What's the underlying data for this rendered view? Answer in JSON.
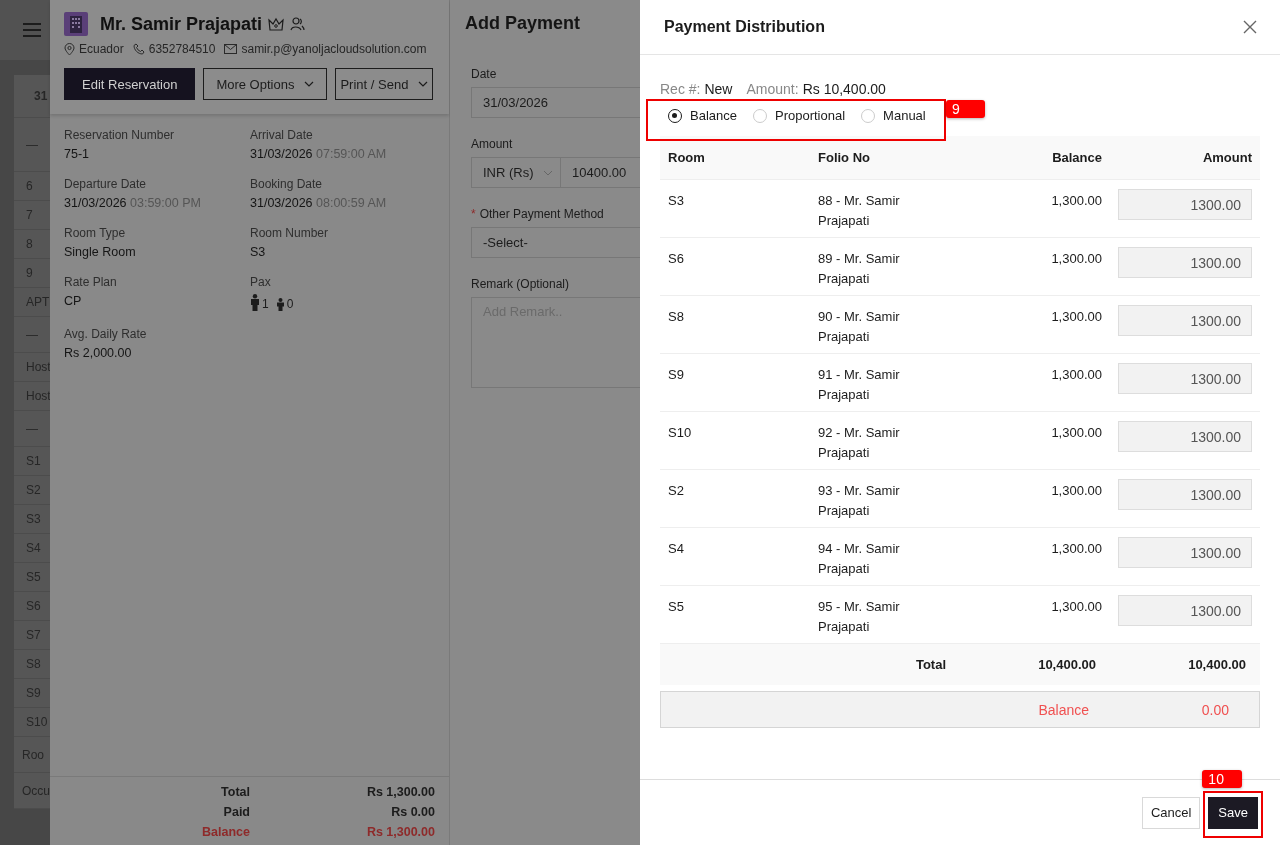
{
  "background_list": {
    "rows": [
      {
        "kind": "header",
        "text": "31"
      },
      {
        "kind": "group",
        "text": "—"
      },
      {
        "kind": "row",
        "text": "6"
      },
      {
        "kind": "row",
        "text": "7"
      },
      {
        "kind": "row",
        "text": "8"
      },
      {
        "kind": "row",
        "text": "9"
      },
      {
        "kind": "row",
        "text": "APT"
      },
      {
        "kind": "group",
        "text": "—"
      },
      {
        "kind": "row",
        "text": "Host"
      },
      {
        "kind": "row",
        "text": "Host"
      },
      {
        "kind": "group",
        "text": "—"
      },
      {
        "kind": "row",
        "text": "S1"
      },
      {
        "kind": "row",
        "text": "S2"
      },
      {
        "kind": "row",
        "text": "S3"
      },
      {
        "kind": "row",
        "text": "S4"
      },
      {
        "kind": "row",
        "text": "S5"
      },
      {
        "kind": "row",
        "text": "S6"
      },
      {
        "kind": "row",
        "text": "S7"
      },
      {
        "kind": "row",
        "text": "S8"
      },
      {
        "kind": "row",
        "text": "S9"
      },
      {
        "kind": "row",
        "text": "S10"
      },
      {
        "kind": "footer",
        "text": "Roo"
      },
      {
        "kind": "footer",
        "text": "Occu"
      }
    ]
  },
  "reservation": {
    "guest_name": "Mr. Samir Prajapati",
    "country": "Ecuador",
    "phone": "6352784510",
    "email": "samir.p@yanoljacloudsolution.com",
    "buttons": [
      {
        "label": "Edit Reservation",
        "kind": "primary"
      },
      {
        "label": "More Options",
        "kind": "dropdown"
      },
      {
        "label": "Print / Send",
        "kind": "dropdown"
      }
    ],
    "details": [
      {
        "kind": "text",
        "label": "Reservation Number",
        "value": "75-1"
      },
      {
        "kind": "text",
        "label": "Arrival Date",
        "value": "31/03/2026",
        "time": "07:59:00 AM"
      },
      {
        "kind": "text",
        "label": "Departure Date",
        "value": "31/03/2026",
        "time": "03:59:00 PM"
      },
      {
        "kind": "text",
        "label": "Booking Date",
        "value": "31/03/2026",
        "time": "08:00:59 AM"
      },
      {
        "kind": "text",
        "label": "Room Type",
        "value": "Single Room"
      },
      {
        "kind": "text",
        "label": "Room Number",
        "value": "S3"
      },
      {
        "kind": "text",
        "label": "Rate Plan",
        "value": "CP"
      },
      {
        "kind": "pax",
        "label": "Pax",
        "adults": "1",
        "children": "0"
      },
      {
        "kind": "text",
        "label": "Avg. Daily Rate",
        "value": "Rs 2,000.00"
      }
    ],
    "summary": [
      {
        "label": "Total",
        "value": "Rs 1,300.00",
        "due": false
      },
      {
        "label": "Paid",
        "value": "Rs 0.00",
        "due": false
      },
      {
        "label": "Balance",
        "value": "Rs 1,300.00",
        "due": true
      }
    ]
  },
  "add_payment": {
    "title": "Add Payment",
    "date": {
      "label": "Date",
      "value": "31/03/2026"
    },
    "amount": {
      "label": "Amount",
      "currency": "INR (Rs)",
      "value": "10400.00"
    },
    "method": {
      "label": "Other Payment Method",
      "required_mark": "*",
      "value": "-Select-"
    },
    "remark": {
      "label": "Remark (Optional)",
      "placeholder": "Add Remark.."
    }
  },
  "payment_distribution": {
    "title": "Payment Distribution",
    "rec_label": "Rec #:",
    "rec_value": "New",
    "amount_label": "Amount:",
    "amount_value": "Rs 10,400.00",
    "options": [
      {
        "label": "Balance",
        "selected": true
      },
      {
        "label": "Proportional",
        "selected": false
      },
      {
        "label": "Manual",
        "selected": false
      }
    ],
    "columns": [
      "Room",
      "Folio No",
      "Balance",
      "Amount"
    ],
    "rows": [
      {
        "room": "S3",
        "folio": "88 - Mr. Samir Prajapati",
        "balance": "1,300.00",
        "amount": "1300.00"
      },
      {
        "room": "S6",
        "folio": "89 - Mr. Samir Prajapati",
        "balance": "1,300.00",
        "amount": "1300.00"
      },
      {
        "room": "S8",
        "folio": "90 - Mr. Samir Prajapati",
        "balance": "1,300.00",
        "amount": "1300.00"
      },
      {
        "room": "S9",
        "folio": "91 - Mr. Samir Prajapati",
        "balance": "1,300.00",
        "amount": "1300.00"
      },
      {
        "room": "S10",
        "folio": "92 - Mr. Samir Prajapati",
        "balance": "1,300.00",
        "amount": "1300.00"
      },
      {
        "room": "S2",
        "folio": "93 - Mr. Samir Prajapati",
        "balance": "1,300.00",
        "amount": "1300.00"
      },
      {
        "room": "S4",
        "folio": "94 - Mr. Samir Prajapati",
        "balance": "1,300.00",
        "amount": "1300.00"
      },
      {
        "room": "S5",
        "folio": "95 - Mr. Samir Prajapati",
        "balance": "1,300.00",
        "amount": "1300.00"
      }
    ],
    "total": {
      "label": "Total",
      "balance": "10,400.00",
      "amount": "10,400.00"
    },
    "remaining": {
      "label": "Balance",
      "value": "0.00"
    },
    "buttons": [
      {
        "label": "Cancel",
        "kind": "secondary"
      },
      {
        "label": "Save",
        "kind": "primary"
      }
    ]
  },
  "callouts": [
    {
      "number": "9"
    },
    {
      "number": "10"
    }
  ]
}
